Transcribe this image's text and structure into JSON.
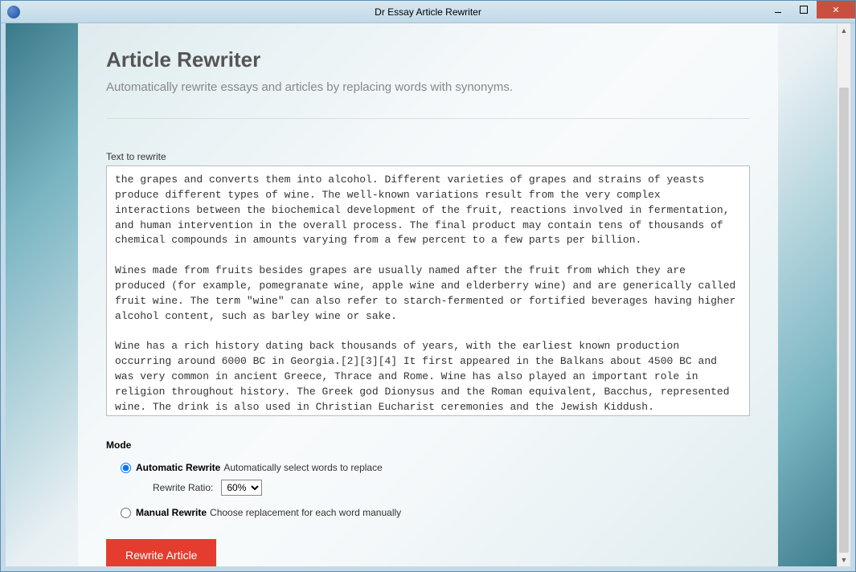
{
  "window": {
    "title": "Dr Essay Article Rewriter"
  },
  "page": {
    "heading": "Article Rewriter",
    "subheading": "Automatically rewrite essays and articles by replacing words with synonyms."
  },
  "form": {
    "textarea_label": "Text to rewrite",
    "textarea_value": "the grapes and converts them into alcohol. Different varieties of grapes and strains of yeasts produce different types of wine. The well-known variations result from the very complex interactions between the biochemical development of the fruit, reactions involved in fermentation, and human intervention in the overall process. The final product may contain tens of thousands of chemical compounds in amounts varying from a few percent to a few parts per billion.\n\nWines made from fruits besides grapes are usually named after the fruit from which they are produced (for example, pomegranate wine, apple wine and elderberry wine) and are generically called fruit wine. The term \"wine\" can also refer to starch-fermented or fortified beverages having higher alcohol content, such as barley wine or sake.\n\nWine has a rich history dating back thousands of years, with the earliest known production occurring around 6000 BC in Georgia.[2][3][4] It first appeared in the Balkans about 4500 BC and was very common in ancient Greece, Thrace and Rome. Wine has also played an important role in religion throughout history. The Greek god Dionysus and the Roman equivalent, Bacchus, represented wine. The drink is also used in Christian Eucharist ceremonies and the Jewish Kiddush."
  },
  "mode": {
    "heading": "Mode",
    "auto": {
      "label": "Automatic Rewrite",
      "desc": "Automatically select words to replace"
    },
    "ratio": {
      "label": "Rewrite Ratio:",
      "value": "60%"
    },
    "manual": {
      "label": "Manual Rewrite",
      "desc": "Choose replacement for each word manually"
    }
  },
  "button": {
    "rewrite": "Rewrite Article"
  }
}
